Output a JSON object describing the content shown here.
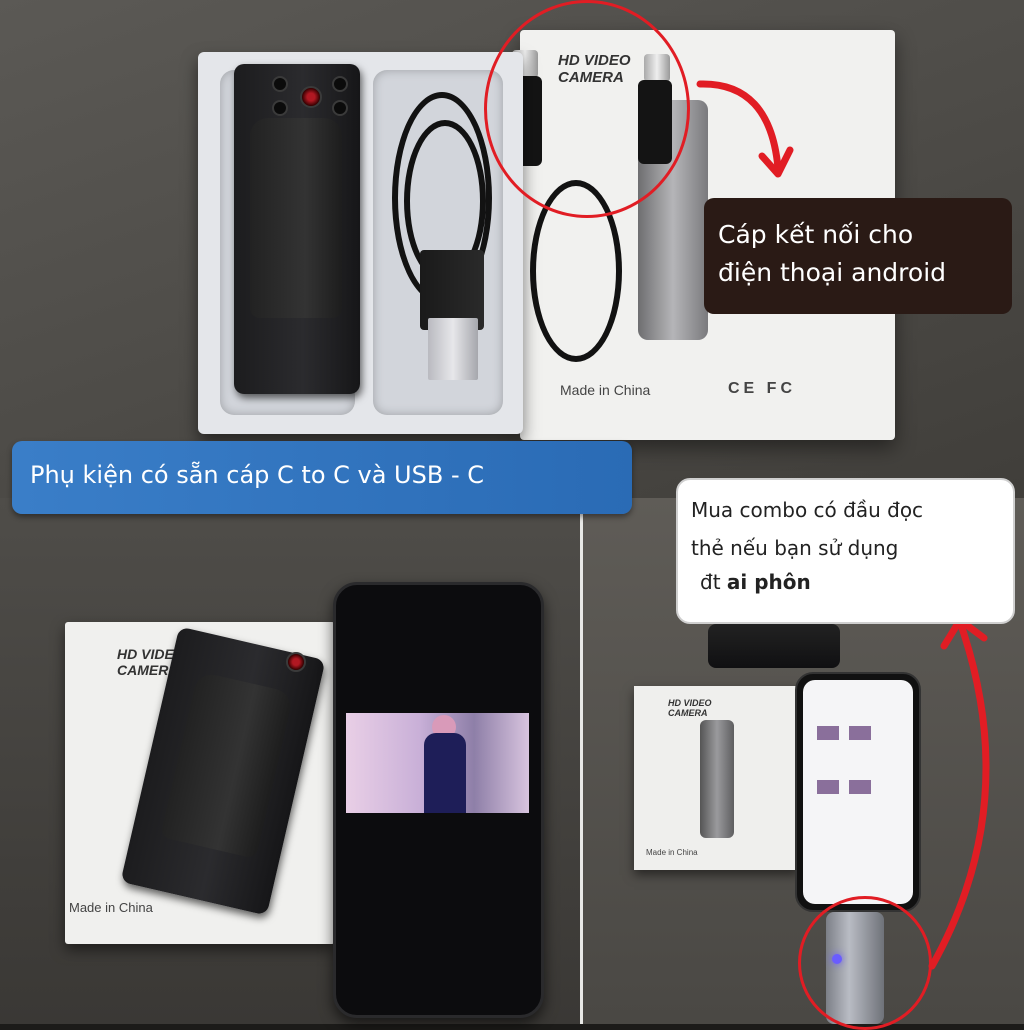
{
  "top_panel": {
    "box_brand": "HD VIDEO\nCAMERA",
    "box_made": "Made in China",
    "box_marks": "CE FC",
    "callout": {
      "line1": "Cáp  kết nối cho",
      "line2": "điện thoại android"
    }
  },
  "banner": {
    "text": "Phụ kiện có sẵn cáp C to C và USB - C"
  },
  "callout_white": {
    "line1": "Mua combo có đầu đọc",
    "line2": "thẻ nếu bạn sử dụng",
    "line3_prefix": "đt ",
    "line3_bold": "ai phôn"
  },
  "bottom_left": {
    "box_brand": "HD VIDEO\nCAMERA",
    "box_made": "Made in China"
  },
  "bottom_right": {
    "box_brand": "HD VIDEO\nCAMERA",
    "box_made": "Made in China"
  },
  "colors": {
    "accent_red": "#e11d24",
    "banner_blue": "#2a6bb5",
    "callout_dark": "#2a1a15"
  }
}
